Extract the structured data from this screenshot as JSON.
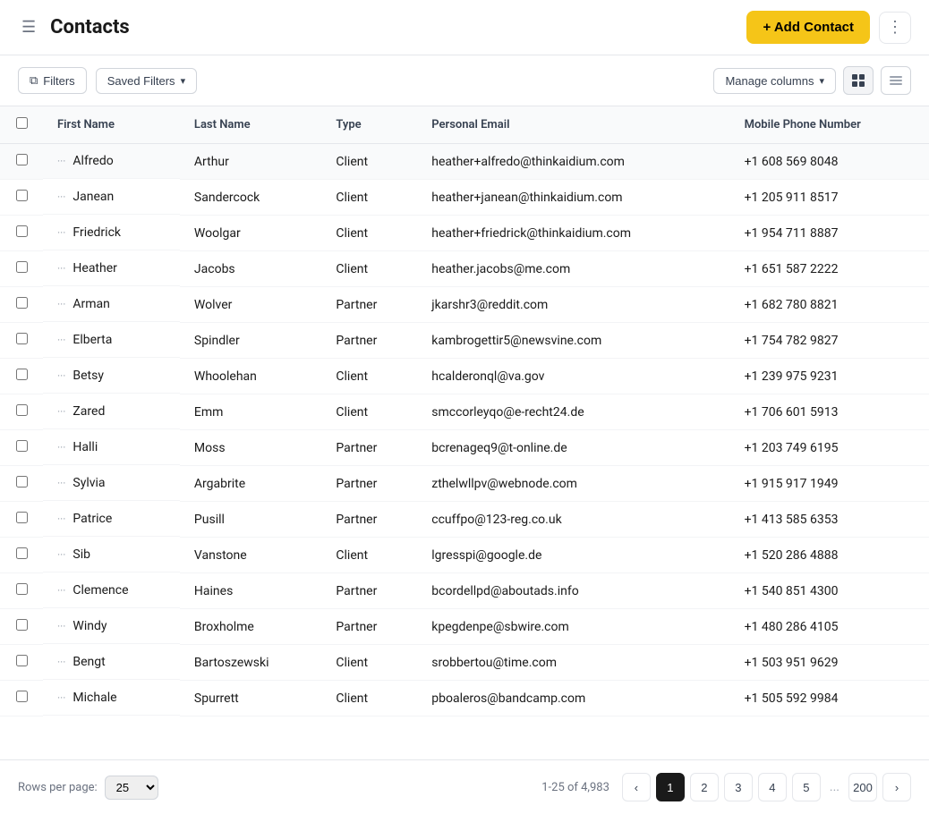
{
  "header": {
    "title": "Contacts",
    "add_contact_label": "+ Add Contact",
    "more_icon": "⋮"
  },
  "toolbar": {
    "filters_label": "Filters",
    "saved_filters_label": "Saved Filters",
    "manage_columns_label": "Manage columns"
  },
  "table": {
    "columns": [
      "First Name",
      "Last Name",
      "Type",
      "Personal Email",
      "Mobile Phone Number"
    ],
    "rows": [
      {
        "first": "Alfredo",
        "last": "Arthur",
        "type": "Client",
        "email": "heather+alfredo@thinkaidium.com",
        "phone": "+1 608 569 8048"
      },
      {
        "first": "Janean",
        "last": "Sandercock",
        "type": "Client",
        "email": "heather+janean@thinkaidium.com",
        "phone": "+1 205 911 8517"
      },
      {
        "first": "Friedrick",
        "last": "Woolgar",
        "type": "Client",
        "email": "heather+friedrick@thinkaidium.com",
        "phone": "+1 954 711 8887"
      },
      {
        "first": "Heather",
        "last": "Jacobs",
        "type": "Client",
        "email": "heather.jacobs@me.com",
        "phone": "+1 651 587 2222"
      },
      {
        "first": "Arman",
        "last": "Wolver",
        "type": "Partner",
        "email": "jkarshr3@reddit.com",
        "phone": "+1 682 780 8821"
      },
      {
        "first": "Elberta",
        "last": "Spindler",
        "type": "Partner",
        "email": "kambrogettir5@newsvine.com",
        "phone": "+1 754 782 9827"
      },
      {
        "first": "Betsy",
        "last": "Whoolehan",
        "type": "Client",
        "email": "hcalderonql@va.gov",
        "phone": "+1 239 975 9231"
      },
      {
        "first": "Zared",
        "last": "Emm",
        "type": "Client",
        "email": "smccorleyqo@e-recht24.de",
        "phone": "+1 706 601 5913"
      },
      {
        "first": "Halli",
        "last": "Moss",
        "type": "Partner",
        "email": "bcrenageq9@t-online.de",
        "phone": "+1 203 749 6195"
      },
      {
        "first": "Sylvia",
        "last": "Argabrite",
        "type": "Partner",
        "email": "zthelwllpv@webnode.com",
        "phone": "+1 915 917 1949"
      },
      {
        "first": "Patrice",
        "last": "Pusill",
        "type": "Partner",
        "email": "ccuffpo@123-reg.co.uk",
        "phone": "+1 413 585 6353"
      },
      {
        "first": "Sib",
        "last": "Vanstone",
        "type": "Client",
        "email": "lgresspi@google.de",
        "phone": "+1 520 286 4888"
      },
      {
        "first": "Clemence",
        "last": "Haines",
        "type": "Partner",
        "email": "bcordellpd@aboutads.info",
        "phone": "+1 540 851 4300"
      },
      {
        "first": "Windy",
        "last": "Broxholme",
        "type": "Partner",
        "email": "kpegdenpe@sbwire.com",
        "phone": "+1 480 286 4105"
      },
      {
        "first": "Bengt",
        "last": "Bartoszewski",
        "type": "Client",
        "email": "srobbertou@time.com",
        "phone": "+1 503 951 9629"
      },
      {
        "first": "Michale",
        "last": "Spurrett",
        "type": "Client",
        "email": "pboaleros@bandcamp.com",
        "phone": "+1 505 592 9984"
      }
    ]
  },
  "footer": {
    "rows_per_page_label": "Rows per page:",
    "rows_per_page_value": "25",
    "pagination_info": "1-25 of 4,983",
    "pages": [
      "1",
      "2",
      "3",
      "4",
      "5",
      "...",
      "200"
    ],
    "active_page": "1"
  }
}
